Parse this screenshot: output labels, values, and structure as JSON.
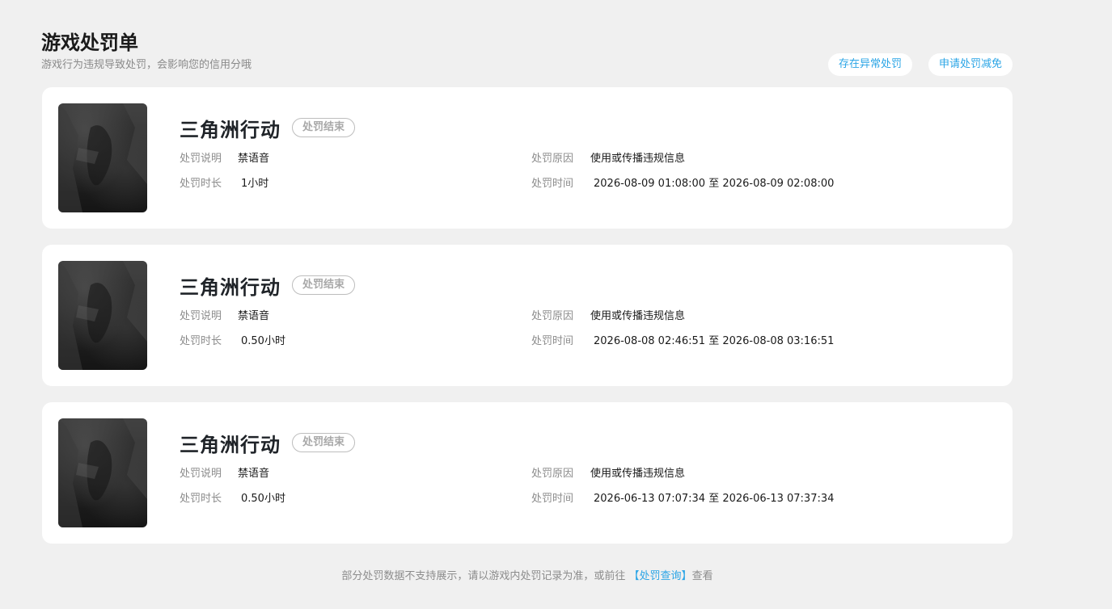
{
  "header": {
    "title": "游戏处罚单",
    "subtitle": "游戏行为违规导致处罚，会影响您的信用分哦",
    "actions": [
      {
        "label": "存在异常处罚"
      },
      {
        "label": "申请处罚减免"
      }
    ]
  },
  "labels": {
    "description": "处罚说明",
    "reason": "处罚原因",
    "duration": "处罚时长",
    "time": "处罚时间"
  },
  "records": [
    {
      "game": "三角洲行动",
      "status": "处罚结束",
      "description": "禁语音",
      "reason": "使用或传播违规信息",
      "duration": "1小时",
      "time": "2026-08-09 01:08:00 至 2026-08-09 02:08:00"
    },
    {
      "game": "三角洲行动",
      "status": "处罚结束",
      "description": "禁语音",
      "reason": "使用或传播违规信息",
      "duration": "0.50小时",
      "time": "2026-08-08 02:46:51 至 2026-08-08 03:16:51"
    },
    {
      "game": "三角洲行动",
      "status": "处罚结束",
      "description": "禁语音",
      "reason": "使用或传播违规信息",
      "duration": "0.50小时",
      "time": "2026-06-13 07:07:34 至 2026-06-13 07:37:34"
    }
  ],
  "footer": {
    "text_before": "部分处罚数据不支持展示，请以游戏内处罚记录为准，或前往 ",
    "link": "【处罚查询】",
    "text_after": "查看"
  },
  "colors": {
    "accent": "#2ba5e6",
    "background": "#f0f0f0",
    "card": "#ffffff"
  }
}
